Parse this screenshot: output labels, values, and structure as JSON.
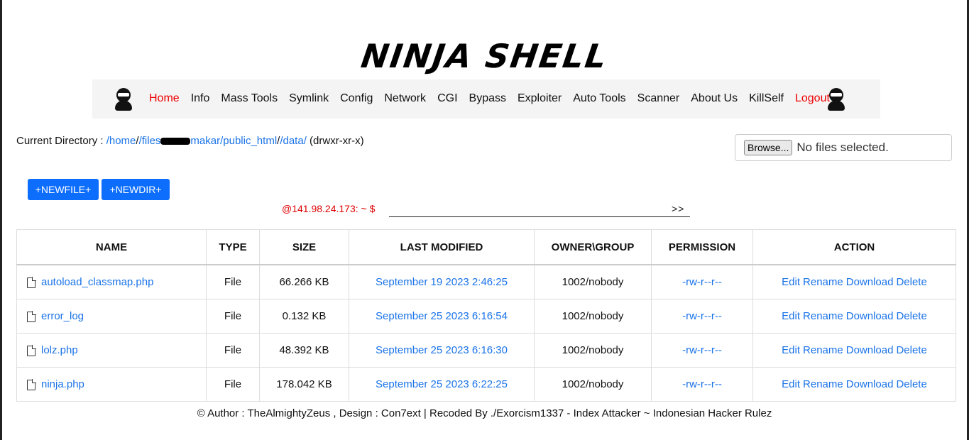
{
  "title": "NINJA SHELL",
  "nav": {
    "items": [
      {
        "label": "Home",
        "color": "#e00000"
      },
      {
        "label": "Info"
      },
      {
        "label": "Mass Tools"
      },
      {
        "label": "Symlink"
      },
      {
        "label": "Config"
      },
      {
        "label": "Network"
      },
      {
        "label": "CGI"
      },
      {
        "label": "Bypass"
      },
      {
        "label": "Exploiter"
      },
      {
        "label": "Auto Tools"
      },
      {
        "label": "Scanner"
      },
      {
        "label": "About Us"
      },
      {
        "label": "KillSelf"
      },
      {
        "label": "Logout",
        "color": "#e00000"
      }
    ]
  },
  "current_dir": {
    "label": "Current Directory :",
    "path_parts": [
      "/home",
      "/files",
      "makar",
      "/public_html",
      "/data/"
    ],
    "separator": "/",
    "permissions": "(drwxr-xr-x)"
  },
  "upload": {
    "browse_label": "Browse...",
    "status": "No files selected."
  },
  "buttons": {
    "newfile": "+NEWFILE+",
    "newdir": "+NEWDIR+"
  },
  "command": {
    "prompt": "@141.98.24.173: ~ $",
    "go": ">>"
  },
  "table": {
    "headers": [
      "NAME",
      "TYPE",
      "SIZE",
      "LAST MODIFIED",
      "OWNER\\GROUP",
      "PERMISSION",
      "ACTION"
    ],
    "rows": [
      {
        "name": "autoload_classmap.php",
        "type": "File",
        "size": "66.266 KB",
        "modified": "September 19 2023 2:46:25",
        "owner": "1002/nobody",
        "perm": "-rw-r--r--"
      },
      {
        "name": "error_log",
        "type": "File",
        "size": "0.132 KB",
        "modified": "September 25 2023 6:16:54",
        "owner": "1002/nobody",
        "perm": "-rw-r--r--"
      },
      {
        "name": "lolz.php",
        "type": "File",
        "size": "48.392 KB",
        "modified": "September 25 2023 6:16:30",
        "owner": "1002/nobody",
        "perm": "-rw-r--r--"
      },
      {
        "name": "ninja.php",
        "type": "File",
        "size": "178.042 KB",
        "modified": "September 25 2023 6:22:25",
        "owner": "1002/nobody",
        "perm": "-rw-r--r--"
      }
    ],
    "actions": [
      "Edit",
      "Rename",
      "Download",
      "Delete"
    ]
  },
  "footer": "© Author : TheAlmightyZeus , Design : Con7ext | Recoded By ./Exorcism1337 - Index Attacker ~ Indonesian Hacker Rulez",
  "colors": {
    "link": "#1a73e8",
    "accent_red": "#e00000",
    "button": "#0d6efd"
  }
}
